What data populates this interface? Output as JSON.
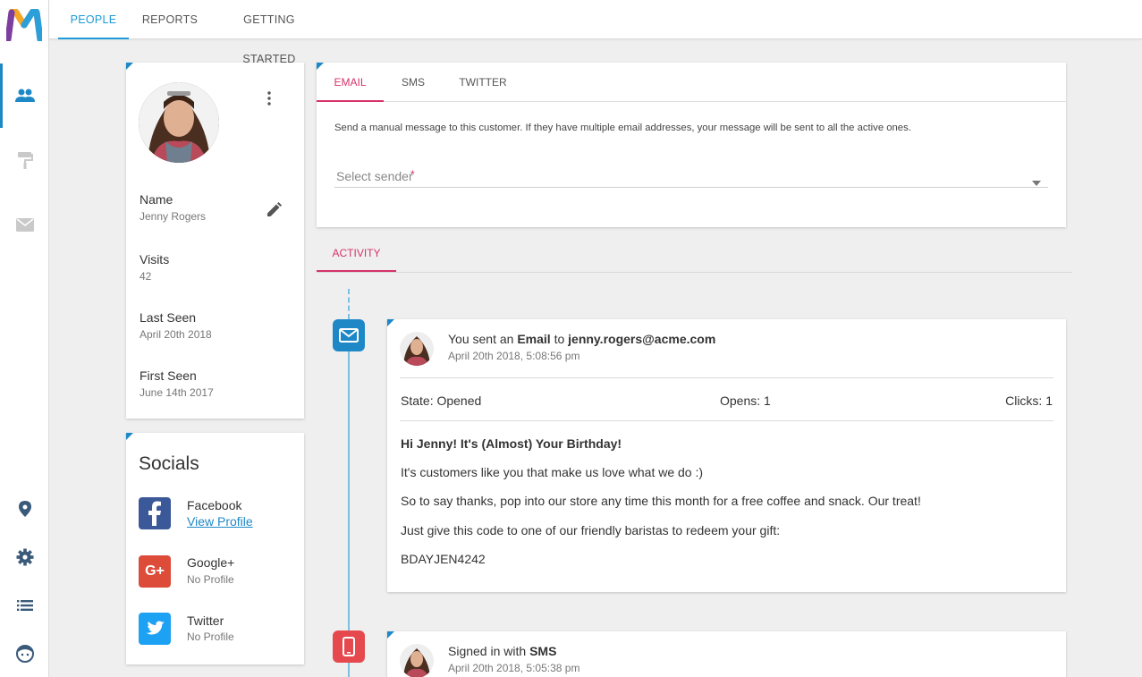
{
  "nav": {
    "tabs": [
      {
        "label": "PEOPLE",
        "active": true
      },
      {
        "label": "REPORTS",
        "active": false
      },
      {
        "label": "GETTING STARTED",
        "active": false
      }
    ]
  },
  "sidebar": {
    "icons": [
      "people-icon",
      "paint-roller-icon",
      "mail-icon",
      "location-icon",
      "gear-icon",
      "list-icon",
      "face-icon"
    ]
  },
  "profile": {
    "fields": [
      {
        "label": "Name",
        "value": "Jenny Rogers"
      },
      {
        "label": "Visits",
        "value": "42"
      },
      {
        "label": "Last Seen",
        "value": "April 20th 2018"
      },
      {
        "label": "First Seen",
        "value": "June 14th 2017"
      }
    ]
  },
  "socials": {
    "title": "Socials",
    "items": [
      {
        "name": "Facebook",
        "sub": "View Profile",
        "link": true,
        "color": "#3b5998"
      },
      {
        "name": "Google+",
        "sub": "No Profile",
        "link": false,
        "color": "#dd4b39"
      },
      {
        "name": "Twitter",
        "sub": "No Profile",
        "link": false,
        "color": "#1da1f2"
      }
    ]
  },
  "message": {
    "tabs": [
      {
        "label": "EMAIL",
        "active": true
      },
      {
        "label": "SMS",
        "active": false
      },
      {
        "label": "TWITTER",
        "active": false
      }
    ],
    "description": "Send a manual message to this customer. If they have multiple email addresses, your message will be sent to all the active ones.",
    "sender_placeholder": "Select sender",
    "required_mark": "*"
  },
  "activity": {
    "tab_label": "ACTIVITY",
    "events": [
      {
        "prefix": "You sent an ",
        "bold1": "Email",
        "mid": " to ",
        "bold2": "jenny.rogers@acme.com",
        "timestamp": "April 20th 2018, 5:08:56 pm",
        "state": "State: Opened",
        "opens": "Opens: 1",
        "clicks": "Clicks: 1",
        "subject": "Hi Jenny! It's (Almost) Your Birthday!",
        "lines": [
          "It's customers like you that make us love what we do :)",
          "So to say thanks, pop into our store any time this month for a free coffee and snack. Our treat!",
          "Just give this code to one of our friendly baristas to redeem your gift:",
          "BDAYJEN4242"
        ]
      },
      {
        "prefix": "Signed in with ",
        "bold1": "SMS",
        "timestamp": "April 20th 2018, 5:05:38 pm"
      }
    ]
  },
  "colors": {
    "accent_blue": "#1e88c7",
    "accent_pink": "#d6336c",
    "email_icon_bg": "#1e88c7",
    "sms_icon_bg": "#e5484d"
  }
}
